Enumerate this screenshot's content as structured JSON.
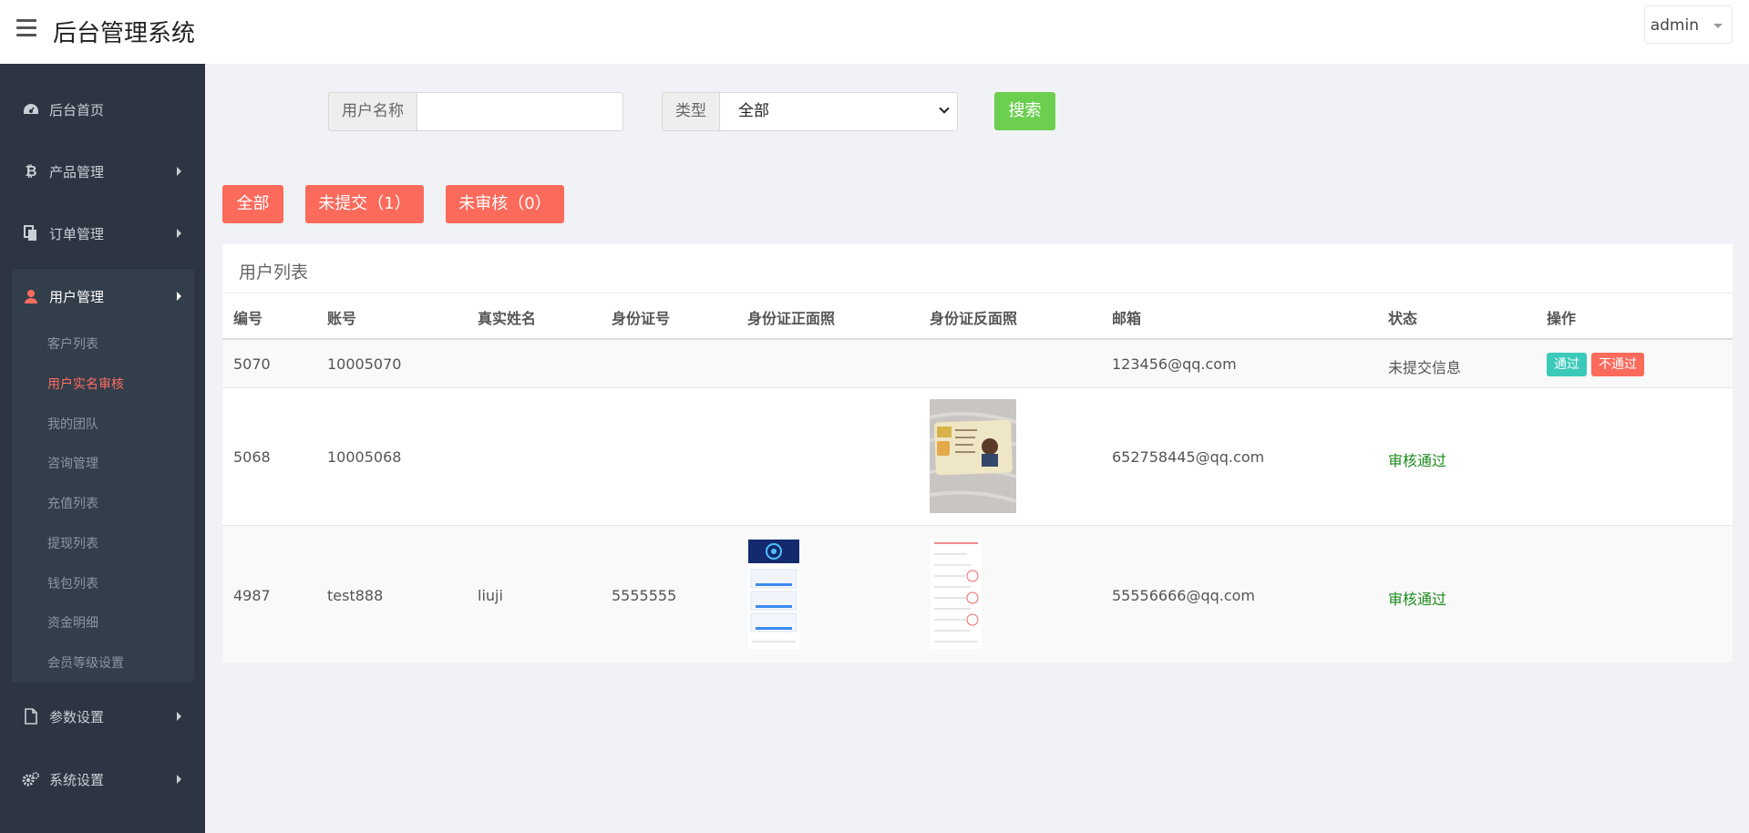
{
  "header": {
    "title": "后台管理系统",
    "user": "admin"
  },
  "sidebar": {
    "items": [
      {
        "label": "后台首页",
        "icon": "dashboard-icon"
      },
      {
        "label": "产品管理",
        "icon": "bitcoin-icon"
      },
      {
        "label": "订单管理",
        "icon": "copy-icon"
      },
      {
        "label": "用户管理",
        "icon": "user-icon"
      },
      {
        "label": "参数设置",
        "icon": "file-icon"
      },
      {
        "label": "系统设置",
        "icon": "cogs-icon"
      }
    ],
    "submenu": [
      "客户列表",
      "用户实名审核",
      "我的团队",
      "咨询管理",
      "充值列表",
      "提现列表",
      "钱包列表",
      "资金明细",
      "会员等级设置"
    ]
  },
  "search": {
    "username_label": "用户名称",
    "username_value": "",
    "type_label": "类型",
    "type_selected": "全部",
    "button": "搜索"
  },
  "filters": [
    "全部",
    "未提交（1）",
    "未审核（0）"
  ],
  "table": {
    "title": "用户列表",
    "columns": [
      "编号",
      "账号",
      "真实姓名",
      "身份证号",
      "身份证正面照",
      "身份证反面照",
      "邮箱",
      "状态",
      "操作"
    ],
    "rows": [
      {
        "id": "5070",
        "account": "10005070",
        "name": "",
        "idno": "",
        "email": "123456@qq.com",
        "status": "未提交信息",
        "actions": [
          "通过",
          "不通过"
        ]
      },
      {
        "id": "5068",
        "account": "10005068",
        "name": "",
        "idno": "",
        "email": "652758445@qq.com",
        "status": "审核通过"
      },
      {
        "id": "4987",
        "account": "test888",
        "name": "liuji",
        "idno": "5555555",
        "email": "55556666@qq.com",
        "status": "审核通过"
      }
    ]
  },
  "colors": {
    "sidebar": "#2c3541",
    "accent_red": "#fb6a5b",
    "search_green": "#6ccf4f",
    "pass_teal": "#3bc9b9",
    "status_ok": "#1e8a1e"
  }
}
